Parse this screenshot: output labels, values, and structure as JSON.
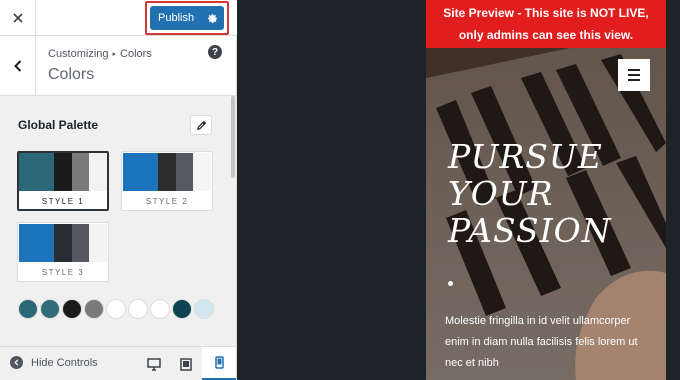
{
  "topbar": {
    "close_icon": "close-icon",
    "publish_label": "Publish",
    "settings_icon": "gear-icon",
    "publish_highlight_color": "#d63638",
    "accent": "#2271b1"
  },
  "header": {
    "back_icon": "chevron-left-icon",
    "breadcrumb_parent": "Customizing",
    "breadcrumb_separator": "▸",
    "title": "Colors",
    "help_icon": "help-icon",
    "help_glyph": "?"
  },
  "global_palette": {
    "title": "Global Palette",
    "edit_icon": "pencil-icon",
    "styles": [
      {
        "label": "STYLE 1",
        "selected": true,
        "colors": [
          "#2b6776",
          "#1b1b1b",
          "#7a7a7a",
          "#f2f2f2"
        ]
      },
      {
        "label": "STYLE 2",
        "selected": false,
        "colors": [
          "#1c75bc",
          "#2d2d2d",
          "#555a60",
          "#f5f5f5"
        ]
      },
      {
        "label": "STYLE 3",
        "selected": false,
        "colors": [
          "#1c75bc",
          "#2a2d33",
          "#55595f",
          "#f4f4f4"
        ]
      }
    ],
    "dots": [
      "#2b6776",
      "#2f6d79",
      "#1b1b1b",
      "#7a7a7a",
      "#ffffff",
      "#ffffff",
      "#ffffff",
      "#0d4251",
      "#d2e6f2"
    ]
  },
  "bottombar": {
    "hide_label": "Hide Controls",
    "hide_icon": "arrow-left-circle-icon",
    "devices": [
      "desktop-icon",
      "tablet-icon",
      "mobile-icon"
    ],
    "active_device": "mobile"
  },
  "preview": {
    "banner_line1": "Site Preview - This site is NOT LIVE,",
    "banner_line2": "only admins can see this view.",
    "menu_icon": "hamburger-menu-icon",
    "heading_line1": "PURSUE",
    "heading_line2": "YOUR",
    "heading_line3": "PASSION",
    "body_text": "Molestie fringilla in id velit ullamcorper enim in diam nulla facilisis felis lorem ut nec et nibh",
    "banner_color": "#e11d1d"
  }
}
